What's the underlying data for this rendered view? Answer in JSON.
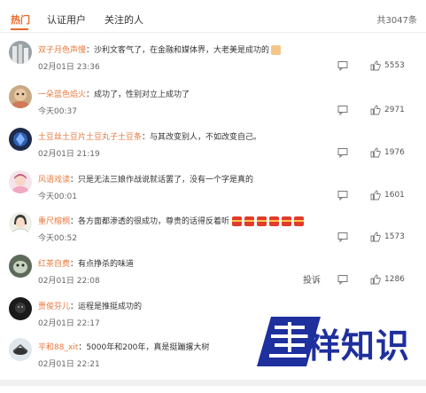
{
  "tabs": {
    "hot": "热门",
    "verified": "认证用户",
    "following": "关注的人"
  },
  "total": "共3047条",
  "comments": [
    {
      "user": "双子月色声慢",
      "text": "沙利文客气了，在金融和媒体界，大老美是成功的",
      "time": "02月01日 23:36",
      "likes": "5553"
    },
    {
      "user": "一朵蓝色焰火",
      "text": "成功了，性别对立上成功了",
      "time": "今天00:37",
      "likes": "2971"
    },
    {
      "user": "土豆丝土豆片土豆丸子土豆条",
      "text": "与其改变别人，不如改变自己。",
      "time": "02月01日 21:19",
      "likes": "1976"
    },
    {
      "user": "风语戏读",
      "text": "只是无法三娘作战说就话罢了，没有一个字是真的",
      "time": "今天00:01",
      "likes": "1601"
    },
    {
      "user": "重尺榕桐",
      "text": "各方面都渗透的很成功，尊贵的话得反着听",
      "time": "今天00:52",
      "likes": "1573"
    },
    {
      "user": "红茶自费",
      "text": "有点挣杀的味道",
      "time": "02月01日 22:08",
      "likes": "1286",
      "report": "投诉"
    },
    {
      "user": "贾俊芬儿",
      "text": "运程是推挺成功的",
      "time": "02月01日 22:17",
      "likes": ""
    },
    {
      "user": "平和88_xit",
      "text": "5000年和200年，真是挺蹦撂大树",
      "time": "02月01日 22:21",
      "likes": ""
    }
  ],
  "watermark": "祥知识",
  "colors": {
    "accent": "#e86a2a",
    "username": "#e8793e",
    "brand": "#1e2f9e"
  }
}
